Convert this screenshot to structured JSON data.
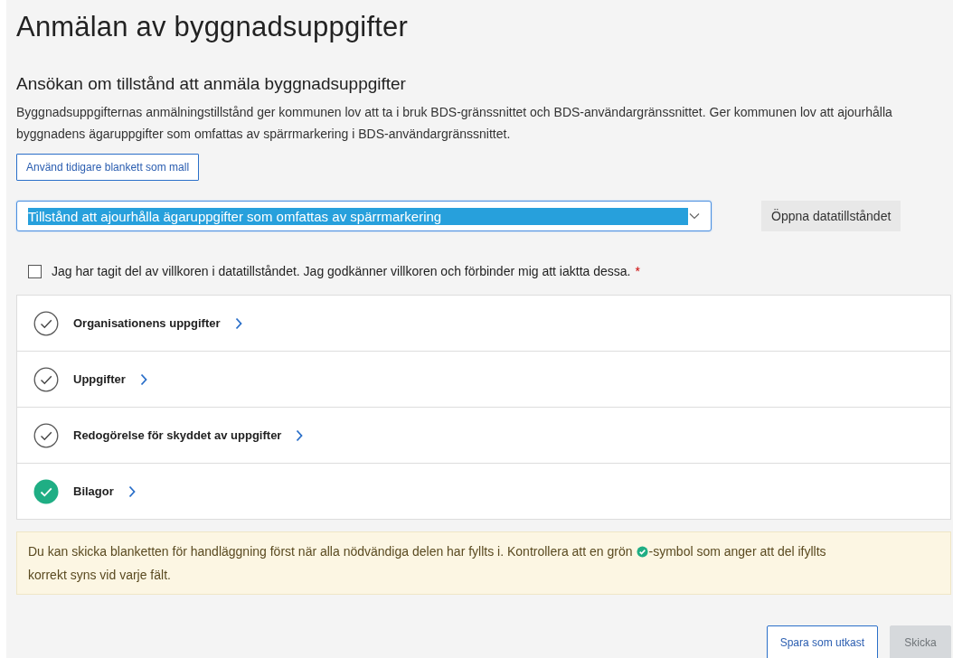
{
  "title": "Anmälan av byggnadsuppgifter",
  "subtitle": "Ansökan om tillstånd att anmäla byggnadsuppgifter",
  "description": "Byggnadsuppgifternas anmälningstillstånd ger kommunen lov att ta i bruk BDS-gränssnittet och BDS-användargränssnittet. Ger kommunen lov att ajourhålla byggnadens ägaruppgifter som omfattas av spärrmarkering i BDS-användargränssnittet.",
  "template_button": "Använd tidigare blankett som mall",
  "permit_select": {
    "value": "Tillstånd att ajourhålla ägaruppgifter som omfattas av spärrmarkering"
  },
  "open_permit_button": "Öppna datatillståndet",
  "terms": {
    "label": "Jag har tagit del av villkoren i datatillståndet. Jag godkänner villkoren och förbinder mig att iaktta dessa.",
    "required_mark": "*",
    "checked": false
  },
  "sections": [
    {
      "label": "Organisationens uppgifter",
      "completed": false
    },
    {
      "label": "Uppgifter",
      "completed": false
    },
    {
      "label": "Redogörelse för skyddet av uppgifter",
      "completed": false
    },
    {
      "label": "Bilagor",
      "completed": true
    }
  ],
  "notice": {
    "text_before": "Du kan skicka blanketten för handläggning först när alla nödvändiga delen har fyllts i. Kontrollera att en grön",
    "text_after": "-symbol som anger att del ifyllts",
    "text_end": "korrekt syns vid varje fält."
  },
  "actions": [
    {
      "label": "Spara som utkast",
      "disabled": false
    },
    {
      "label": "Skicka",
      "disabled": true
    }
  ]
}
